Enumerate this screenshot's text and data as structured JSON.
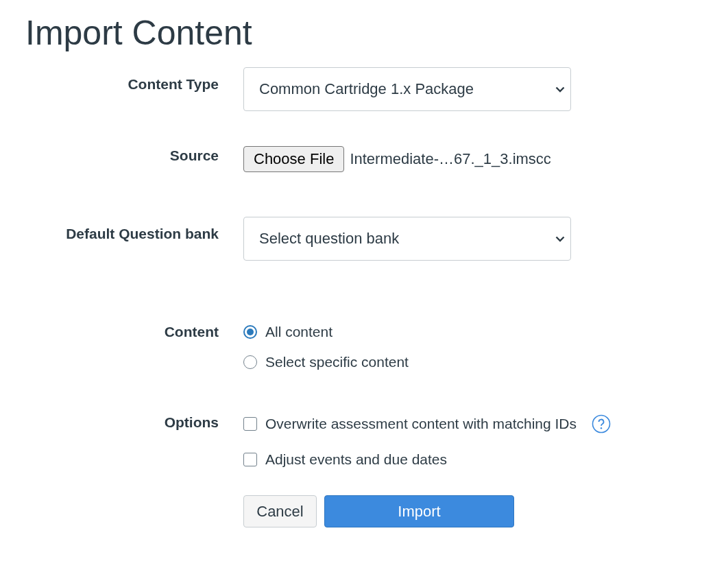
{
  "title": "Import Content",
  "content_type": {
    "label": "Content Type",
    "value": "Common Cartridge 1.x Package"
  },
  "source": {
    "label": "Source",
    "button": "Choose File",
    "file_name": "Intermediate-…67._1_3.imscc"
  },
  "question_bank": {
    "label": "Default Question bank",
    "value": "Select question bank"
  },
  "content": {
    "label": "Content",
    "options": [
      {
        "label": "All content",
        "selected": true
      },
      {
        "label": "Select specific content",
        "selected": false
      }
    ]
  },
  "options": {
    "label": "Options",
    "items": [
      {
        "label": "Overwrite assessment content with matching IDs",
        "checked": false,
        "has_help": true
      },
      {
        "label": "Adjust events and due dates",
        "checked": false,
        "has_help": false
      }
    ]
  },
  "buttons": [
    {
      "label": "Cancel",
      "kind": "secondary"
    },
    {
      "label": "Import",
      "kind": "primary"
    }
  ]
}
